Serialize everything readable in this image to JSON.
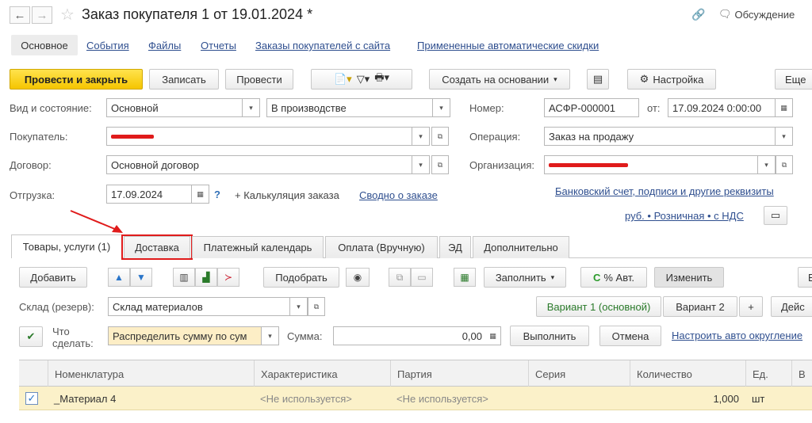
{
  "header": {
    "title": "Заказ покупателя 1 от 19.01.2024 *",
    "discussion": "Обсуждение"
  },
  "section_tabs": [
    "Основное",
    "События",
    "Файлы",
    "Отчеты",
    "Заказы покупателей с сайта",
    "Примененные автоматические скидки"
  ],
  "toolbar": {
    "post_close": "Провести и закрыть",
    "save": "Записать",
    "post": "Провести",
    "create_based": "Создать на основании",
    "settings": "Настройка",
    "more": "Еще"
  },
  "form": {
    "kind_label": "Вид и состояние:",
    "kind_value": "Основной",
    "state_value": "В производстве",
    "number_label": "Номер:",
    "number_value": "АСФР-000001",
    "from_label": "от:",
    "date_value": "17.09.2024  0:00:00",
    "customer_label": "Покупатель:",
    "operation_label": "Операция:",
    "operation_value": "Заказ на продажу",
    "contract_label": "Договор:",
    "contract_value": "Основной договор",
    "org_label": "Организация:",
    "shipment_label": "Отгрузка:",
    "shipment_date": "17.09.2024",
    "question": "?",
    "calc": "+ Калькуляция заказа",
    "summary_link": "Сводно о заказе",
    "bank_link": "Банковский счет, подписи и другие реквизиты",
    "price_link": "руб. • Розничная • с НДС"
  },
  "tabs": [
    "Товары, услуги (1)",
    "Доставка",
    "Платежный календарь",
    "Оплата (Вручную)",
    "ЭД",
    "Дополнительно"
  ],
  "goods_toolbar": {
    "add": "Добавить",
    "pick": "Подобрать",
    "fill": "Заполнить",
    "auto_pct": "% Авт.",
    "change": "Изменить",
    "more_cut": "Е"
  },
  "warehouse": {
    "label": "Склад (резерв):",
    "value": "Склад материалов",
    "variant1": "Вариант 1 (основной)",
    "variant2": "Вариант 2",
    "plus": "+",
    "actions_cut": "Дейс"
  },
  "todo": {
    "label": "Что сделать:",
    "value": "Распределить сумму по сум",
    "sum_label": "Сумма:",
    "sum_value": "0,00",
    "run": "Выполнить",
    "cancel": "Отмена",
    "rounding_link": "Настроить авто округление"
  },
  "table": {
    "columns": [
      "Номенклатура",
      "Характеристика",
      "Партия",
      "Серия",
      "Количество",
      "Ед.",
      "В"
    ],
    "rows": [
      {
        "name": "_Материал 4",
        "characteristic": "<Не используется>",
        "batch": "<Не используется>",
        "series": "",
        "qty": "1,000",
        "unit": "шт"
      }
    ]
  },
  "colors": {
    "accent_yellow": "#f5c500",
    "link": "#2f4f8f",
    "highlight_red": "#e01b1b"
  }
}
